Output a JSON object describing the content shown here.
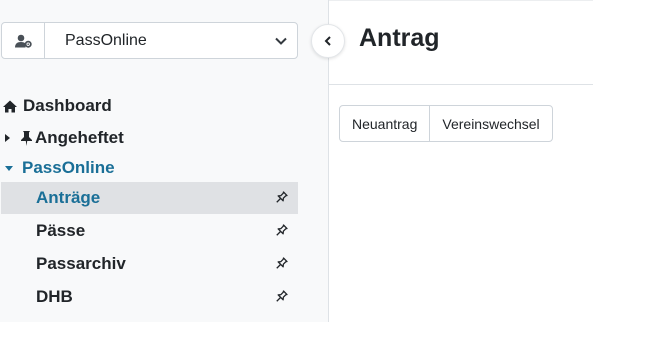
{
  "sidebar": {
    "app_select": {
      "value": "PassOnline",
      "icon": "user-gear-icon"
    },
    "collapse_icon": "chevron-left-icon",
    "nav": {
      "dashboard": {
        "label": "Dashboard",
        "icon": "home-icon"
      },
      "pinned": {
        "label": "Angeheftet",
        "icon": "pin-icon",
        "expander": "caret-right-icon"
      },
      "passonline": {
        "label": "PassOnline",
        "expander": "caret-down-icon"
      }
    },
    "items": [
      {
        "label": "Anträge",
        "active": true,
        "icon": "pin-outline-icon"
      },
      {
        "label": "Pässe",
        "active": false,
        "icon": "pin-outline-icon"
      },
      {
        "label": "Passarchiv",
        "active": false,
        "icon": "pin-outline-icon"
      },
      {
        "label": "DHB",
        "active": false,
        "icon": "pin-outline-icon"
      }
    ]
  },
  "main": {
    "title": "Antrag",
    "buttons": {
      "new": "Neuantrag",
      "club_change": "Vereinswechsel"
    }
  },
  "colors": {
    "accent": "#1a6f97",
    "active_bg": "#dfe1e4",
    "sidebar_bg": "#f8f9fa"
  }
}
